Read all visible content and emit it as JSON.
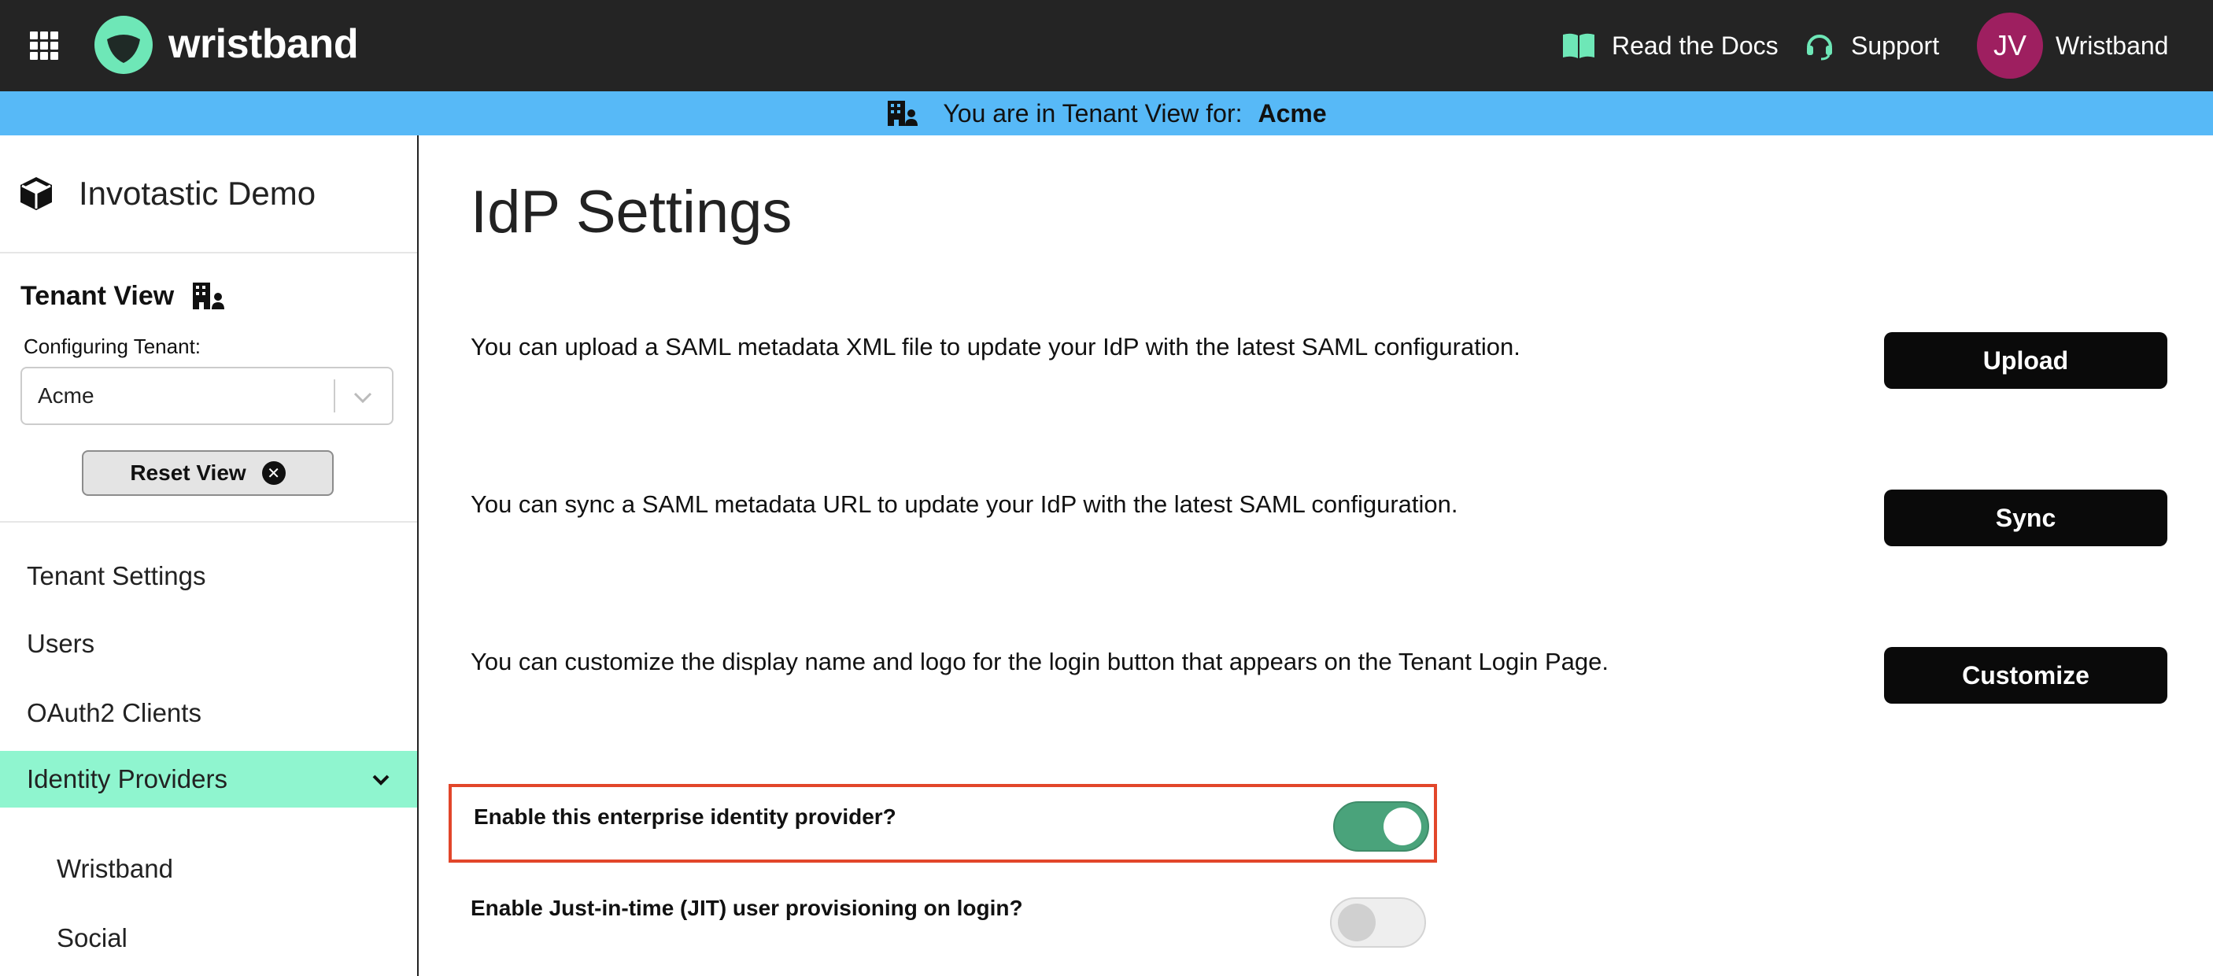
{
  "topbar": {
    "brand": "wristband",
    "docs_label": "Read the Docs",
    "support_label": "Support",
    "avatar_initials": "JV",
    "user_label": "Wristband",
    "background": "#242424",
    "accent": "#6ee7b7",
    "avatar_color": "#9e1f60"
  },
  "banner": {
    "prefix": "You are in Tenant View for:",
    "tenant": "Acme",
    "color": "#57b9f7"
  },
  "sidebar": {
    "app_name": "Invotastic Demo",
    "tenant_view_title": "Tenant View",
    "configuring_label": "Configuring Tenant:",
    "selected_tenant": "Acme",
    "reset_label": "Reset View",
    "nav": [
      {
        "label": "Tenant Settings"
      },
      {
        "label": "Users"
      },
      {
        "label": "OAuth2 Clients"
      },
      {
        "label": "Identity Providers",
        "active": true
      }
    ],
    "subnav": [
      {
        "label": "Wristband"
      },
      {
        "label": "Social"
      }
    ],
    "active_color": "#8ff5cf"
  },
  "main": {
    "title": "IdP Settings",
    "rows": [
      {
        "text": "You can upload a SAML metadata XML file to update your IdP with the latest SAML configuration.",
        "button": "Upload"
      },
      {
        "text": "You can sync a SAML metadata URL to update your IdP with the latest SAML configuration.",
        "button": "Sync"
      },
      {
        "text": "You can customize the display name and logo for the login button that appears on the Tenant Login Page.",
        "button": "Customize"
      }
    ],
    "toggles": [
      {
        "label": "Enable this enterprise identity provider?",
        "on": true,
        "highlighted": true
      },
      {
        "label": "Enable Just-in-time (JIT) user provisioning on login?",
        "on": false,
        "highlighted": false
      }
    ],
    "highlight_color": "#e2462a",
    "toggle_on_color": "#4aa37b"
  }
}
